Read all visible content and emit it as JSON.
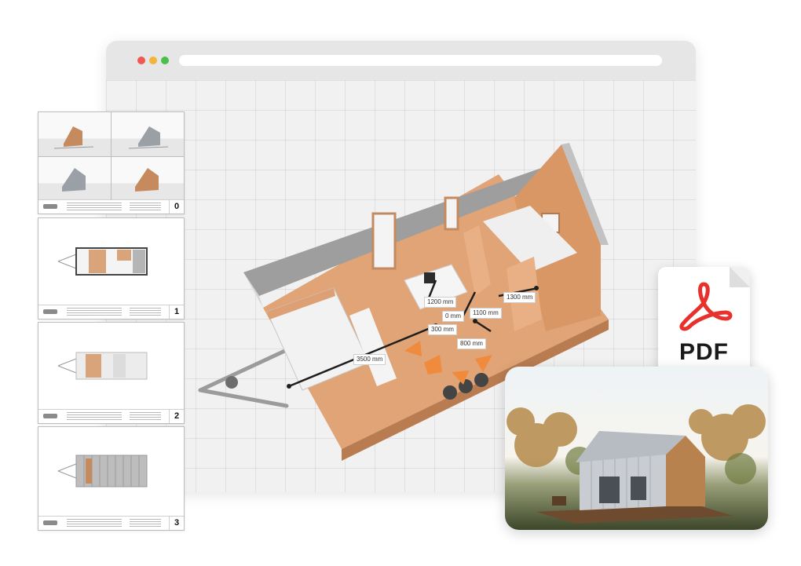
{
  "window": {
    "dots": [
      "red",
      "yellow",
      "green"
    ]
  },
  "floorplan": {
    "dimensions": [
      "1200 mm",
      "0 mm",
      "1100 mm",
      "1300 mm",
      "300 mm",
      "800 mm",
      "3500 mm"
    ]
  },
  "sheets": [
    {
      "number": "0"
    },
    {
      "number": "1"
    },
    {
      "number": "2"
    },
    {
      "number": "3"
    }
  ],
  "pdf": {
    "label": "PDF",
    "icon": "adobe-acrobat-icon",
    "accent": "#e8312c"
  },
  "colors": {
    "wood": "#e3a97a",
    "arrow": "#f08a3c"
  }
}
